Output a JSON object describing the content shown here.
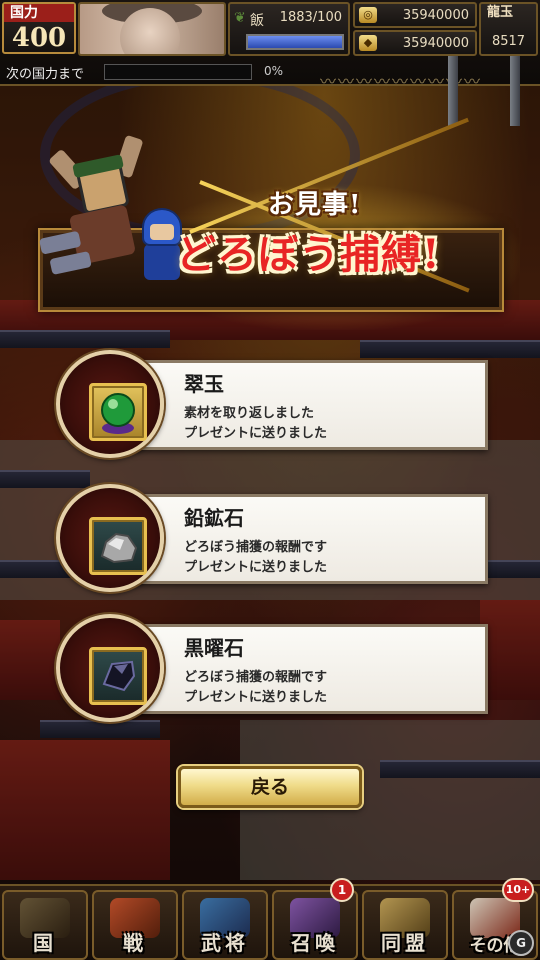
{
  "hud": {
    "power_label": "国力",
    "power_value": "400",
    "food_label": "飯",
    "food_value": "1883/100",
    "food_fill": 1.0,
    "coin_top": "35940000",
    "coin_bottom": "35940000",
    "ryugyoku_label": "龍玉",
    "ryugyoku_value": "8517",
    "next_label": "次の国力まで",
    "next_percent": "0%"
  },
  "banner": {
    "small": "お見事!",
    "big": "どろぼう捕縛!"
  },
  "rewards": [
    {
      "name": "翠玉",
      "line1": "素材を取り返しました",
      "line2": "プレゼントに送りました",
      "icon": "jade-orb-icon"
    },
    {
      "name": "鉛鉱石",
      "line1": "どろぼう捕獲の報酬です",
      "line2": "プレゼントに送りました",
      "icon": "lead-ore-icon"
    },
    {
      "name": "黒曜石",
      "line1": "どろぼう捕獲の報酬です",
      "line2": "プレゼントに送りました",
      "icon": "obsidian-icon"
    }
  ],
  "back_label": "戻る",
  "nav": [
    {
      "label": "国",
      "icon": "flag-icon",
      "badge": ""
    },
    {
      "label": "戦",
      "icon": "swords-icon",
      "badge": ""
    },
    {
      "label": "武将",
      "icon": "general-icon",
      "badge": ""
    },
    {
      "label": "召喚",
      "icon": "summon-icon",
      "badge": "1"
    },
    {
      "label": "同盟",
      "icon": "handshake-icon",
      "badge": ""
    },
    {
      "label": "その他",
      "icon": "dragon-icon",
      "badge": "10+"
    }
  ],
  "colors": {
    "accent_gold": "#e8c050",
    "banner_red": "#e82424",
    "badge_red": "#c81e1e"
  },
  "watermark": "G"
}
